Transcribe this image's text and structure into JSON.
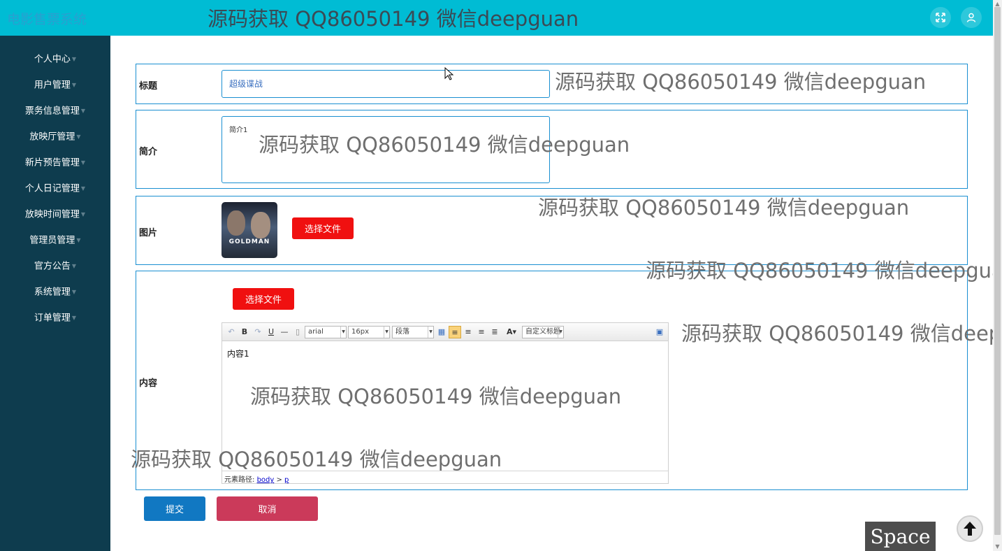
{
  "header": {
    "app_title": "电影售票系统",
    "icons": [
      "fullscreen-icon",
      "user-icon"
    ]
  },
  "sidebar": {
    "items": [
      {
        "label": "个人中心"
      },
      {
        "label": "用户管理"
      },
      {
        "label": "票务信息管理"
      },
      {
        "label": "放映厅管理"
      },
      {
        "label": "新片预告管理"
      },
      {
        "label": "个人日记管理"
      },
      {
        "label": "放映时间管理"
      },
      {
        "label": "管理员管理"
      },
      {
        "label": "官方公告"
      },
      {
        "label": "系统管理"
      },
      {
        "label": "订单管理"
      }
    ]
  },
  "form": {
    "title_label": "标题",
    "title_value": "超级谍战",
    "intro_label": "简介",
    "intro_value": "简介1",
    "image_label": "图片",
    "poster_title": "GOLDMAN",
    "choose_file": "选择文件",
    "content_label": "内容",
    "content_choose_file": "选择文件",
    "submit": "提交",
    "cancel": "取消"
  },
  "editor": {
    "font_family": "arial",
    "font_size": "16px",
    "paragraph": "段落",
    "custom_title": "自定义标题",
    "content_text": "内容1",
    "status_prefix": "元素路径:",
    "path_body": "body",
    "path_sep": " > ",
    "path_p": "p"
  },
  "watermark": {
    "text": "源码获取 QQ86050149 微信deepguan"
  },
  "overlay": {
    "space_label": "Space"
  },
  "colors": {
    "topbar": "#00bcd4",
    "sidebar": "#0e3c4e",
    "accent_border": "#1a8fd1",
    "file_button": "#f01010",
    "submit_button": "#1178c2",
    "cancel_button": "#cb3a5a"
  }
}
